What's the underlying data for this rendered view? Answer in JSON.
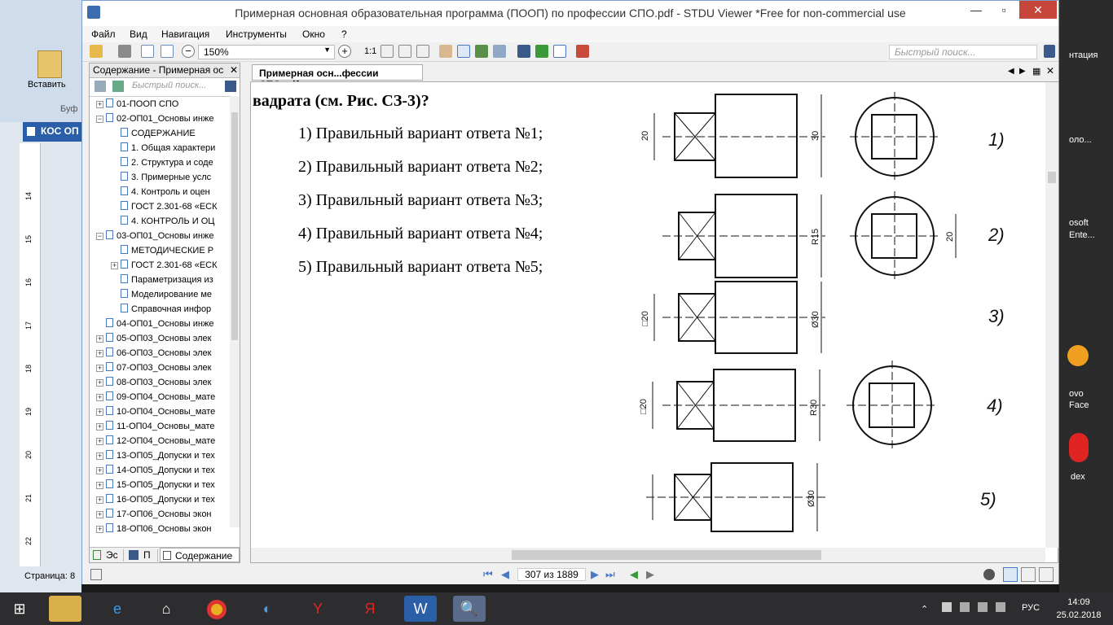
{
  "window": {
    "title": "Примерная основная образовательная программа (ПООП) по профессии СПО.pdf - STDU Viewer *Free for non-commercial use",
    "minimize": "—",
    "restore": "▫",
    "close": "✕"
  },
  "menu": [
    "Файл",
    "Вид",
    "Навигация",
    "Инструменты",
    "Окно",
    "?"
  ],
  "toolbar": {
    "zoom_value": "150%",
    "ratio_label": "1:1",
    "search_placeholder": "Быстрый поиск..."
  },
  "panel": {
    "title": "Содержание - Примерная ос",
    "search_placeholder": "Быстрый поиск...",
    "tree": [
      {
        "label": "01-ПООП СПО",
        "level": 0,
        "expander": "+"
      },
      {
        "label": "02-ОП01_Основы инже",
        "level": 0,
        "expander": "−"
      },
      {
        "label": "СОДЕРЖАНИЕ",
        "level": 1,
        "expander": ""
      },
      {
        "label": "1. Общая характери",
        "level": 1,
        "expander": ""
      },
      {
        "label": "2. Структура и соде",
        "level": 1,
        "expander": ""
      },
      {
        "label": "3. Примерные услс",
        "level": 1,
        "expander": ""
      },
      {
        "label": "4. Контроль и оцен",
        "level": 1,
        "expander": ""
      },
      {
        "label": "ГОСТ 2.301-68 «ЕСК",
        "level": 1,
        "expander": ""
      },
      {
        "label": "4. КОНТРОЛЬ И ОЦ",
        "level": 1,
        "expander": ""
      },
      {
        "label": "03-ОП01_Основы инже",
        "level": 0,
        "expander": "−"
      },
      {
        "label": "МЕТОДИЧЕСКИЕ Р",
        "level": 1,
        "expander": ""
      },
      {
        "label": "ГОСТ 2.301-68 «ЕСК",
        "level": 1,
        "expander": "+"
      },
      {
        "label": "Параметризация из",
        "level": 1,
        "expander": ""
      },
      {
        "label": "Моделирование ме",
        "level": 1,
        "expander": ""
      },
      {
        "label": "Справочная инфор",
        "level": 1,
        "expander": ""
      },
      {
        "label": "04-ОП01_Основы инже",
        "level": 0,
        "expander": ""
      },
      {
        "label": "05-ОП03_Основы элек",
        "level": 0,
        "expander": "+"
      },
      {
        "label": "06-ОП03_Основы элек",
        "level": 0,
        "expander": "+"
      },
      {
        "label": "07-ОП03_Основы элек",
        "level": 0,
        "expander": "+"
      },
      {
        "label": "08-ОП03_Основы элек",
        "level": 0,
        "expander": "+"
      },
      {
        "label": "09-ОП04_Основы_мате",
        "level": 0,
        "expander": "+"
      },
      {
        "label": "10-ОП04_Основы_мате",
        "level": 0,
        "expander": "+"
      },
      {
        "label": "11-ОП04_Основы_мате",
        "level": 0,
        "expander": "+"
      },
      {
        "label": "12-ОП04_Основы_мате",
        "level": 0,
        "expander": "+"
      },
      {
        "label": "13-ОП05_Допуски и тех",
        "level": 0,
        "expander": "+"
      },
      {
        "label": "14-ОП05_Допуски и тех",
        "level": 0,
        "expander": "+"
      },
      {
        "label": "15-ОП05_Допуски и тех",
        "level": 0,
        "expander": "+"
      },
      {
        "label": "16-ОП05_Допуски и тех",
        "level": 0,
        "expander": "+"
      },
      {
        "label": "17-ОП06_Основы экон",
        "level": 0,
        "expander": "+"
      },
      {
        "label": "18-ОП06_Основы экон",
        "level": 0,
        "expander": "+"
      }
    ],
    "bottom_tabs": [
      "Эс",
      "П",
      "Содержание"
    ]
  },
  "document": {
    "tab_label": "Примерная осн...фессии СПО.pdf",
    "heading": "вадрата (см. Рис. СЗ-3)?",
    "answers": [
      "1) Правильный вариант ответа №1;",
      "2) Правильный вариант ответа №2;",
      "3) Правильный вариант ответа №3;",
      "4) Правильный вариант ответа №4;",
      "5) Правильный вариант ответа №5;"
    ],
    "figure_labels": [
      "1)",
      "2)",
      "3)",
      "4)",
      "5)"
    ],
    "dimension_labels": [
      "20",
      "30",
      "R15",
      "20",
      "□20",
      "Ø30",
      "□20",
      "R30",
      "Ø30"
    ]
  },
  "status": {
    "page_indicator": "307 из 1889"
  },
  "word_background": {
    "paste_label": "Вставить",
    "clipboard_label": "Буф",
    "doc_title": "КОС ОП",
    "status_text": "Страница: 8",
    "ruler_numbers": [
      "14",
      "15",
      "16",
      "17",
      "18",
      "19",
      "20",
      "21",
      "22"
    ]
  },
  "desktop_right": {
    "texts": [
      "нтация",
      "оло...",
      "osoft",
      "Ente...",
      "ovo",
      "Face",
      "dex"
    ]
  },
  "taskbar": {
    "lang": "РУС",
    "time": "14:09",
    "date": "25.02.2018"
  }
}
